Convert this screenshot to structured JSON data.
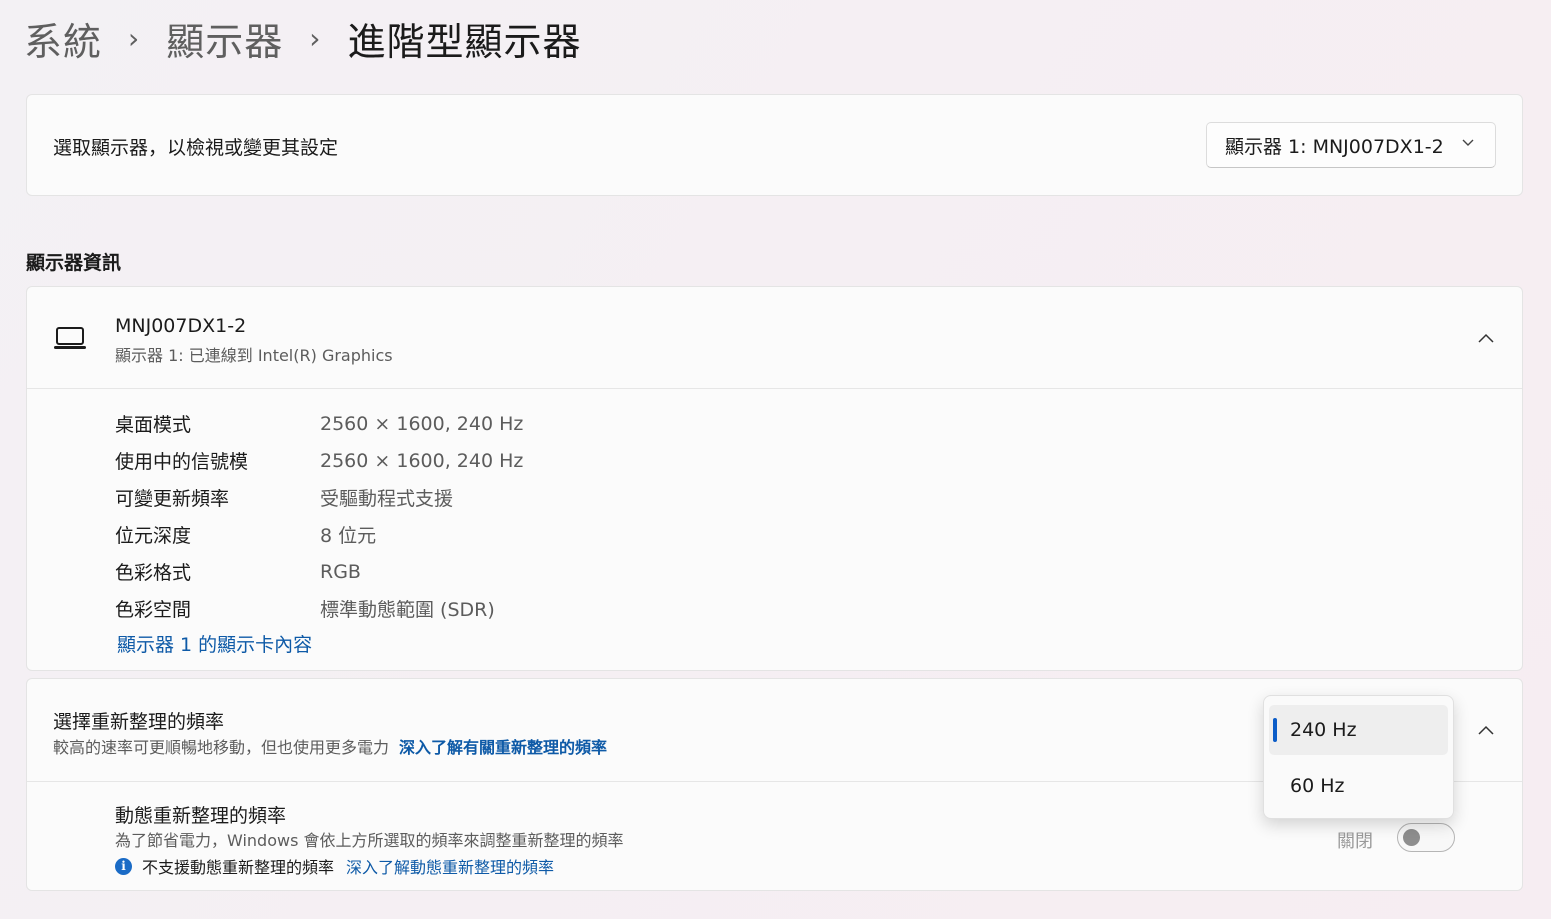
{
  "breadcrumb": {
    "items": [
      "系統",
      "顯示器",
      "進階型顯示器"
    ]
  },
  "display_select": {
    "label": "選取顯示器，以檢視或變更其設定",
    "selected": "顯示器 1: MNJ007DX1-2"
  },
  "section_title": "顯示器資訊",
  "display_info": {
    "name": "MNJ007DX1-2",
    "subtitle": "顯示器 1: 已連線到 Intel(R) Graphics",
    "rows": [
      {
        "key": "桌面模式",
        "value": "2560 × 1600, 240 Hz"
      },
      {
        "key": "使用中的信號模",
        "value": "2560 × 1600, 240 Hz"
      },
      {
        "key": "可變更新頻率",
        "value": "受驅動程式支援"
      },
      {
        "key": "位元深度",
        "value": "8 位元"
      },
      {
        "key": "色彩格式",
        "value": "RGB"
      },
      {
        "key": "色彩空間",
        "value": "標準動態範圍 (SDR)"
      }
    ],
    "adapter_link": "顯示器 1 的顯示卡內容"
  },
  "refresh": {
    "title": "選擇重新整理的頻率",
    "subtitle": "較高的速率可更順暢地移動，但也使用更多電力",
    "learn_link": "深入了解有關重新整理的頻率",
    "options": [
      "240 Hz",
      "60 Hz"
    ],
    "selected_option": "240 Hz"
  },
  "dynamic": {
    "title": "動態重新整理的頻率",
    "subtitle": "為了節省電力，Windows 會依上方所選取的頻率來調整重新整理的頻率",
    "note": "不支援動態重新整理的頻率",
    "note_link": "深入了解動態重新整理的頻率",
    "toggle_label": "關閉",
    "toggle_on": false
  },
  "colors": {
    "accent": "#0b5cc7",
    "link": "#0e5aa7"
  }
}
